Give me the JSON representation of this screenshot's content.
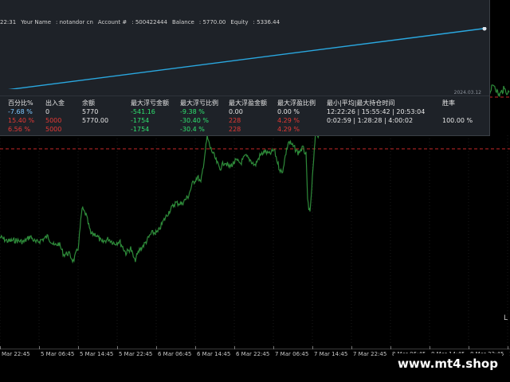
{
  "header": {
    "time": "22:31",
    "name_label": "Your Name",
    "name_value": ": notandor cn",
    "account_label": "Account #",
    "account_value": ": 500422444",
    "balance_label": "Balance",
    "balance_value": ": 5770.00",
    "equity_label": "Equity",
    "equity_value": ": 5336.44"
  },
  "equity_curve": {
    "date": "2024.03.12",
    "color": "#2aa8e0"
  },
  "stats": {
    "columns": [
      "百分比%",
      "出入金",
      "余额",
      "最大浮亏金额",
      "最大浮亏比例",
      "最大浮盈金额",
      "最大浮盈比例",
      "最小|平均|最大持仓时间",
      "胜率"
    ],
    "rows": [
      [
        "-7.68 %",
        "0",
        "5770",
        "-541.16",
        "-9.38 %",
        "0.00",
        "0.00 %",
        "12:22:26 | 15:55:42 | 20:53:04",
        ""
      ],
      [
        "15.40 %",
        "5000",
        "5770.00",
        "-1754",
        "-30.40 %",
        "228",
        "4.29 %",
        "0:02:59 | 1:28:28 | 4:00:02",
        "100.00 %"
      ],
      [
        "6.56 %",
        "5000",
        "",
        "-1754",
        "-30.4 %",
        "228",
        "4.29 %",
        "",
        ""
      ]
    ]
  },
  "x_axis": {
    "labels": [
      "Mar 22:45",
      "5 Mar 06:45",
      "5 Mar 14:45",
      "5 Mar 22:45",
      "6 Mar 06:45",
      "6 Mar 14:45",
      "6 Mar 22:45",
      "7 Mar 06:45",
      "7 Mar 14:45",
      "7 Mar 22:45",
      "8 Mar 06:45",
      "8 Mar 14:45",
      "8 Mar 22:45",
      "11 Ma"
    ]
  },
  "right_label": "L",
  "watermark": "www.mt4.shop",
  "colors": {
    "price_line": "#2e8b3a",
    "level_red": "#c62828",
    "grid": "#1c1c1c",
    "pos": "#2ee06e",
    "neg": "#e53935"
  }
}
